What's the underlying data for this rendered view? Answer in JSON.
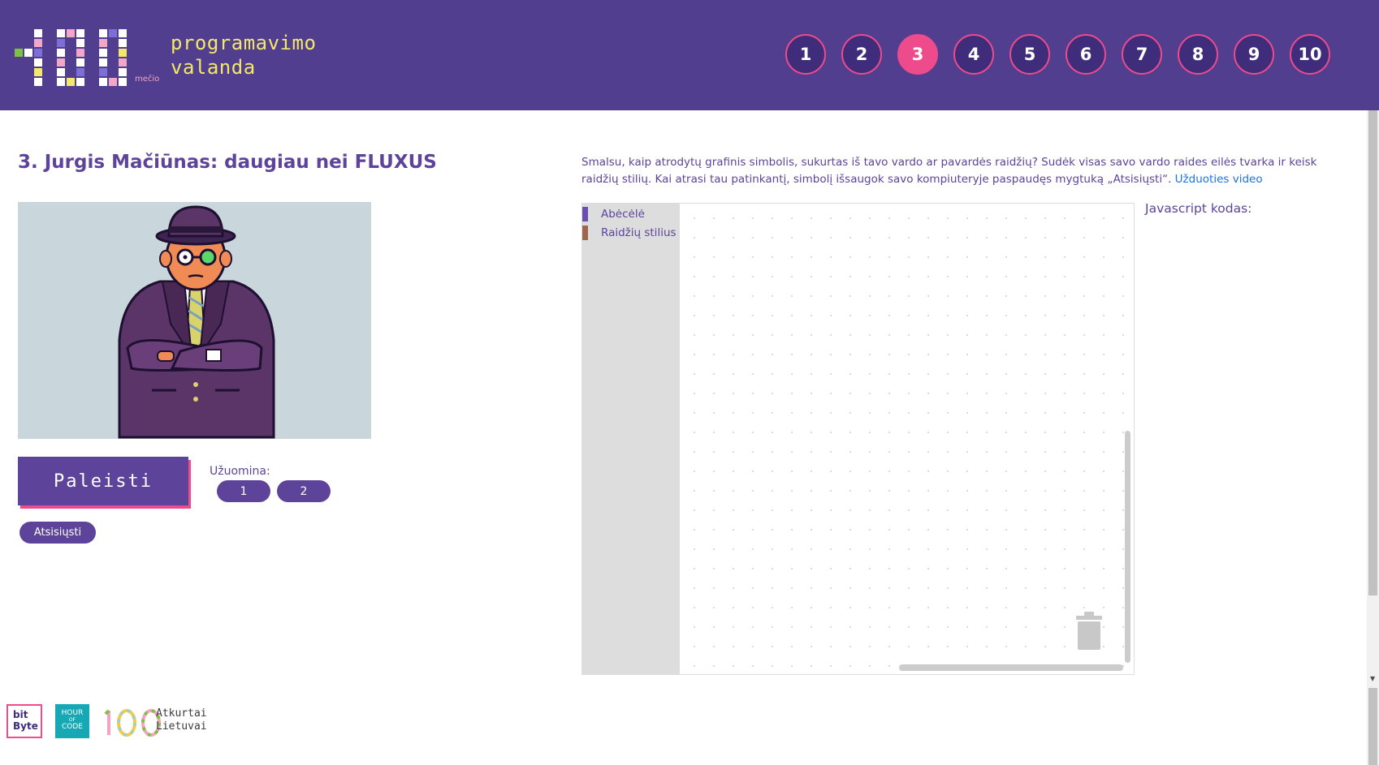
{
  "header": {
    "logo_text_line1": "programavimo",
    "logo_text_line2": "valanda",
    "logo_sub": "mečio",
    "levels": [
      {
        "label": "1",
        "active": false
      },
      {
        "label": "2",
        "active": false
      },
      {
        "label": "3",
        "active": true
      },
      {
        "label": "4",
        "active": false
      },
      {
        "label": "5",
        "active": false
      },
      {
        "label": "6",
        "active": false
      },
      {
        "label": "7",
        "active": false
      },
      {
        "label": "8",
        "active": false
      },
      {
        "label": "9",
        "active": false
      },
      {
        "label": "10",
        "active": false
      }
    ]
  },
  "main": {
    "title": "3. Jurgis Mačiūnas: daugiau nei FLUXUS",
    "run_label": "Paleisti",
    "hint_label": "Užuomina:",
    "hints": [
      "1",
      "2"
    ],
    "download_label": "Atsisiųsti"
  },
  "task": {
    "instructions": "Smalsu, kaip atrodytų grafinis simbolis, sukurtas iš tavo vardo ar pavardės raidžių? Sudėk visas savo vardo raides eilės tvarka ir keisk raidžių stilių. Kai atrasi tau patinkantį, simbolį išsaugok savo kompiuteryje paspaudęs mygtuką „Atsisiųsti“.",
    "video_link": "Užduoties video"
  },
  "workspace": {
    "categories": [
      {
        "label": "Abėcėlė",
        "color": "#6a4fb0"
      },
      {
        "label": "Raidžių stilius",
        "color": "#a0654e"
      }
    ],
    "trash_icon": "trash-icon"
  },
  "code_panel": {
    "label": "Javascript kodas:"
  },
  "footer": {
    "bitbyte_line1": "bit",
    "bitbyte_line2": "Byte",
    "hoc_line1": "HOUR",
    "hoc_line2": "OF",
    "hoc_line3": "CODE",
    "lt_line1": "Atkurtai",
    "lt_line2": "Lietuvai"
  },
  "colors": {
    "header": "#513e8e",
    "accent_pink": "#ee4b8d",
    "purple": "#5d449a",
    "link": "#1a73e8"
  }
}
